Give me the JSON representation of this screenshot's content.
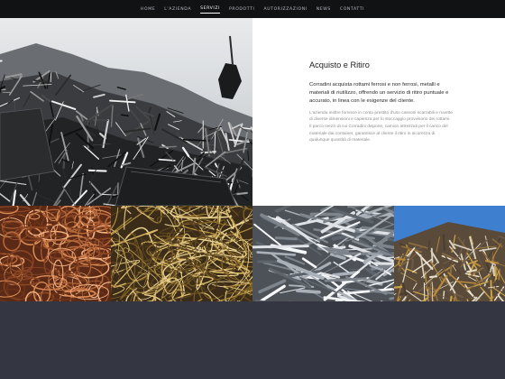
{
  "nav": {
    "items": [
      {
        "label": "HOME",
        "active": false
      },
      {
        "label": "L'AZIENDA",
        "active": false
      },
      {
        "label": "SERVIZI",
        "active": true
      },
      {
        "label": "PRODOTTI",
        "active": false
      },
      {
        "label": "AUTORIZZAZIONI",
        "active": false
      },
      {
        "label": "NEWS",
        "active": false
      },
      {
        "label": "CONTATTI",
        "active": false
      }
    ]
  },
  "section": {
    "title": "Acquisto e Ritiro",
    "lead": "Corradini acquista rottami ferrosi e non ferrosi, metalli e materiali di riutilizzo, offrendo un servizio di ritiro puntuale e accurato, in linea con le esigenze del cliente.",
    "body1": "L'azienda inoltre fornisce in conto prestito d'uso cassoni scarrabili e ruvette di diverse dimensioni e capienza per lo stoccaggio provvisorio dei rottami.",
    "body2": "Il parco mezzi di cui Corradini dispone, camion attrezzati per il carico del materiale dai container, garantisce al cliente il ritiro in sicurezza di qualunque quantità di materiale."
  },
  "colors": {
    "nav_bg": "#111214",
    "footer_bg": "#343741",
    "panel_bg": "#ffffff",
    "copper": "#b8683a",
    "brass": "#b4913f",
    "aluminum": "#a9b0b8",
    "sky": "#3f7fd0"
  },
  "gallery": [
    {
      "name": "copper-wire-photo"
    },
    {
      "name": "brass-wire-photo"
    },
    {
      "name": "aluminum-profiles-photo"
    },
    {
      "name": "mixed-scrap-pile-photo"
    }
  ]
}
